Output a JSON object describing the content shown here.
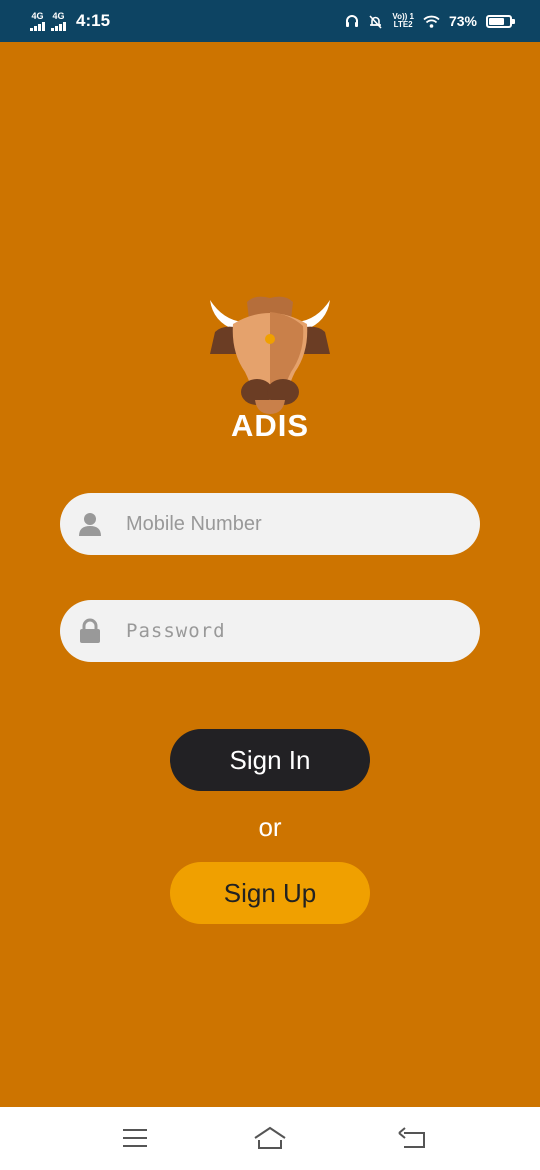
{
  "status_bar": {
    "network1": "4G",
    "network2": "4G",
    "time": "4:15",
    "volte_top": "Vo)) 1",
    "volte_bottom": "LTE2",
    "battery_percent": "73%",
    "battery_level": 0.73
  },
  "app": {
    "name": "ADIS"
  },
  "form": {
    "mobile_placeholder": "Mobile Number",
    "password_placeholder": "Password",
    "signin_label": "Sign In",
    "or_label": "or",
    "signup_label": "Sign Up"
  },
  "icons": {
    "mobile": "user-icon",
    "password": "lock-icon",
    "nav": [
      "menu-icon",
      "home-icon",
      "back-icon"
    ]
  },
  "colors": {
    "background": "#cd7400",
    "status_bar": "#0d4463",
    "field": "#f2f2f2",
    "signin": "#222124",
    "signup": "#f0a000"
  }
}
